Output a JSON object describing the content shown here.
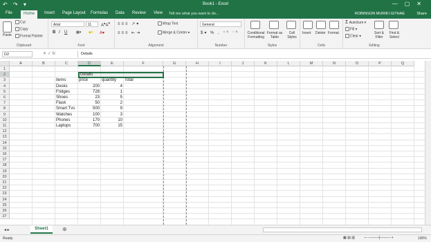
{
  "title_bar": {
    "title": "Book1 - Excel",
    "qat": "↶ ↷ ▾",
    "win": "—▢✕"
  },
  "tabs": [
    "File",
    "Home",
    "Insert",
    "Page Layout",
    "Formulas",
    "Data",
    "Review",
    "View"
  ],
  "tell_me": "Tell me what you want to do...",
  "user": "ROBINSON MURIKI GITHAE",
  "share": "Share",
  "ribbon": {
    "clipboard": {
      "paste": "Paste",
      "cut": "Cut",
      "copy": "Copy",
      "format_painter": "Format Painter",
      "label": "Clipboard"
    },
    "font": {
      "name": "Arial",
      "size": "11",
      "label": "Font"
    },
    "alignment": {
      "wrap": "Wrap Text",
      "merge": "Merge & Center",
      "label": "Alignment"
    },
    "number": {
      "format": "General",
      "label": "Number"
    },
    "styles": {
      "conditional": "Conditional Formatting",
      "format_table": "Format as Table",
      "cell_styles": "Cell Styles",
      "label": "Styles"
    },
    "cells": {
      "insert": "Insert",
      "delete": "Delete",
      "format": "Format",
      "label": "Cells"
    },
    "editing": {
      "autosum": "AutoSum",
      "fill": "Fill",
      "clear": "Clear",
      "sort": "Sort & Filter",
      "find": "Find & Select",
      "label": "Editing"
    }
  },
  "formula_bar": {
    "name_box": "D2",
    "fx": "fx",
    "content": "Details"
  },
  "columns": [
    "A",
    "B",
    "C",
    "D",
    "E",
    "F",
    "G",
    "H",
    "I",
    "J",
    "K",
    "L",
    "M",
    "N",
    "O",
    "P",
    "Q"
  ],
  "rows": [
    "1",
    "2",
    "3",
    "4",
    "5",
    "6",
    "7",
    "8",
    "9",
    "10",
    "11",
    "12",
    "13",
    "14",
    "15",
    "16",
    "17",
    "18",
    "19",
    "20",
    "21",
    "22",
    "23",
    "24",
    "25",
    "26",
    "27"
  ],
  "sheet": {
    "title": "Details",
    "headers": [
      "items",
      "price",
      "quantity",
      "Total"
    ],
    "data": [
      [
        "Desks",
        "200",
        "4"
      ],
      [
        "Fridges",
        "728",
        "1"
      ],
      [
        "Shoes",
        "23",
        "5"
      ],
      [
        "Flask",
        "50",
        "2"
      ],
      [
        "Smart Tvs",
        "500",
        "9"
      ],
      [
        "Watches",
        "100",
        "3"
      ],
      [
        "Phones",
        "170",
        "10"
      ],
      [
        "Laptops",
        "700",
        "15"
      ]
    ]
  },
  "sheet_tab": "Sheet1",
  "status": {
    "ready": "Ready",
    "zoom": "100%"
  }
}
